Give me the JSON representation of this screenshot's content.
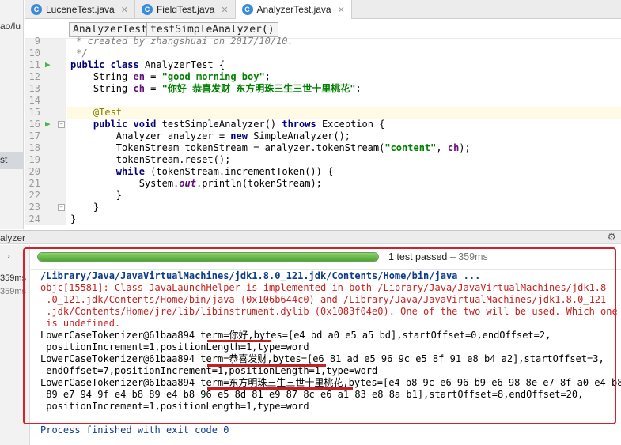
{
  "tabs": [
    {
      "label": "LuceneTest.java",
      "icon": "c-icon",
      "active": false
    },
    {
      "label": "FieldTest.java",
      "icon": "c-icon",
      "active": false
    },
    {
      "label": "AnalyzerTest.java",
      "icon": "c-icon",
      "active": true
    }
  ],
  "left_panel": {
    "path_fragment": "ao/lu",
    "selected_fragment": "st"
  },
  "breadcrumb": [
    "AnalyzerTest",
    "testSimpleAnalyzer()"
  ],
  "editor": {
    "line_numbers": [
      "9",
      "10",
      "11",
      "12",
      "13",
      "14",
      "15",
      "16",
      "17",
      "18",
      "19",
      "20",
      "21",
      "22",
      "23",
      "24"
    ],
    "comment_line": " * created by zhangshuai on 2017/10/10.",
    "comment_end": " */",
    "class_decl": {
      "kw1": "public",
      "kw2": "class",
      "name": " AnalyzerTest {"
    },
    "field_en": {
      "type": "    String ",
      "name": "en",
      "eq": " = ",
      "value": "\"good morning boy\"",
      "end": ";"
    },
    "field_ch": {
      "type": "    String ",
      "name": "ch",
      "eq": " = ",
      "value": "\"你好 恭喜发财 东方明珠三生三世十里桃花\"",
      "end": ";"
    },
    "annotation": "@Test",
    "method_decl": {
      "kw1": "public",
      "kw2": "void",
      "name": " testSimpleAnalyzer() ",
      "kw3": "throws",
      "rest": " Exception {"
    },
    "line17": {
      "a": "        Analyzer analyzer = ",
      "kw": "new",
      "b": " SimpleAnalyzer();"
    },
    "line18": {
      "a": "        TokenStream tokenStream = analyzer.tokenStream(",
      "str": "\"content\"",
      "b": ", ",
      "fld": "ch",
      "c": ");"
    },
    "line19": "        tokenStream.reset();",
    "line20": {
      "kw": "while",
      "rest": " (tokenStream.incrementToken()) {"
    },
    "line21": {
      "a": "            System.",
      "it": "out",
      "b": ".println(tokenStream);"
    },
    "line22": "        }",
    "line23": "    }",
    "line24": "}"
  },
  "run": {
    "window_title": "alyzer",
    "side_times": [
      "359ms",
      "359ms"
    ],
    "progress": 1.0,
    "status": "1 test passed",
    "duration": " – 359ms",
    "console": {
      "java_path": "/Library/Java/JavaVirtualMachines/jdk1.8.0_121.jdk/Contents/Home/bin/java ...",
      "warn": [
        "objc[15581]: Class JavaLaunchHelper is implemented in both /Library/Java/JavaVirtualMachines/jdk1.8",
        " .0_121.jdk/Contents/Home/bin/java (0x106b644c0) and /Library/Java/JavaVirtualMachines/jdk1.8.0_121",
        " .jdk/Contents/Home/jre/lib/libinstrument.dylib (0x1083f04e0). One of the two will be used. Which one",
        " is undefined."
      ],
      "tokens": [
        "LowerCaseTokenizer@61baa894 term=你好,bytes=[e4 bd a0 e5 a5 bd],startOffset=0,endOffset=2,",
        " positionIncrement=1,positionLength=1,type=word",
        "LowerCaseTokenizer@61baa894 term=恭喜发财,bytes=[e6 81 ad e5 96 9c e5 8f 91 e8 b4 a2],startOffset=3,",
        " endOffset=7,positionIncrement=1,positionLength=1,type=word",
        "LowerCaseTokenizer@61baa894 term=东方明珠三生三世十里桃花,bytes=[e4 b8 9c e6 96 b9 e6 98 8e e7 8f a0 e4 b8",
        " 89 e7 94 9f e4 b8 89 e4 b8 96 e5 8d 81 e9 87 8c e6 a1 83 e8 8a b1],startOffset=8,endOffset=20,",
        " positionIncrement=1,positionLength=1,type=word"
      ],
      "exit": "Process finished with exit code 0"
    }
  }
}
